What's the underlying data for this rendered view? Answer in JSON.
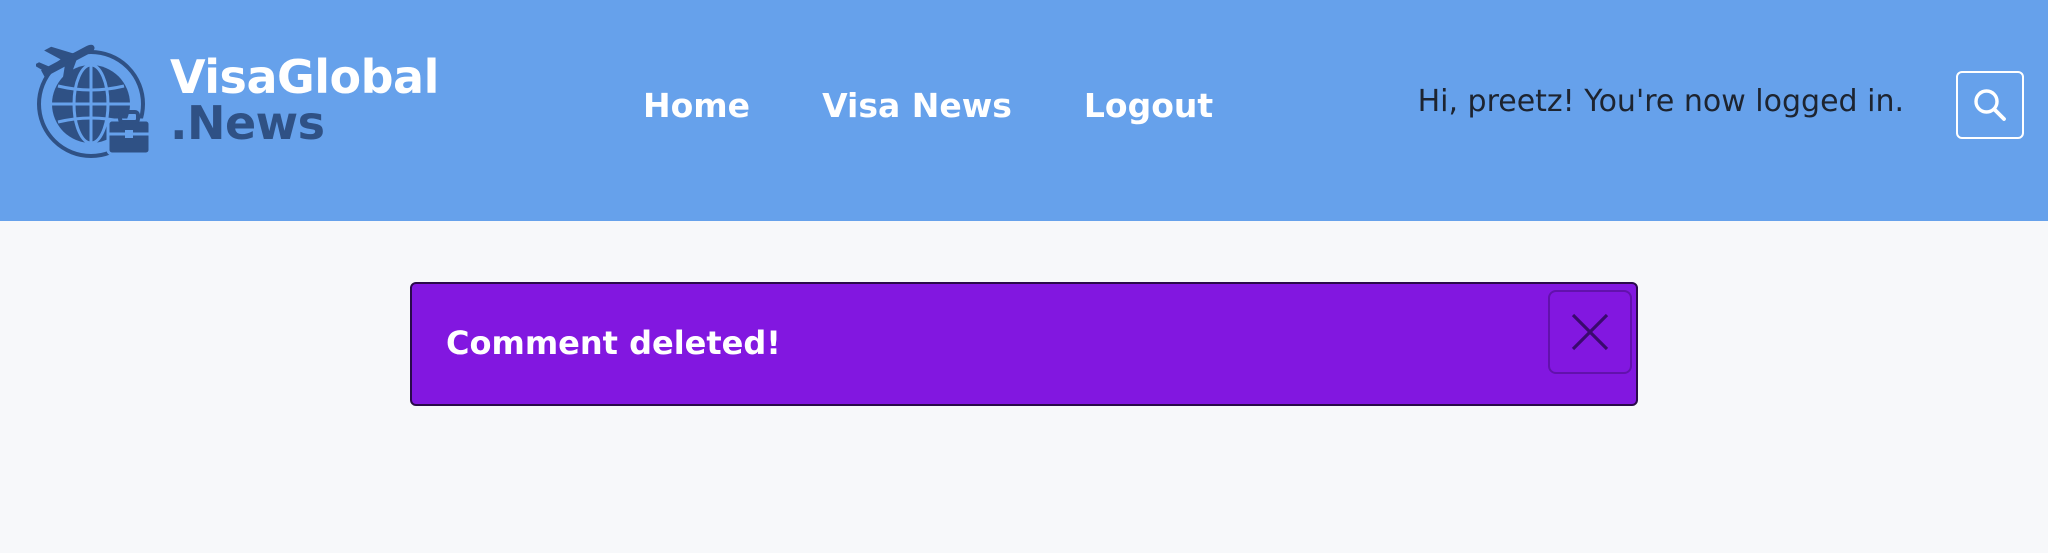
{
  "brand": {
    "line1": "VisaGlobal",
    "line2": ".News",
    "icon": "globe-plane-briefcase-logo"
  },
  "nav": {
    "items": [
      {
        "label": "Home"
      },
      {
        "label": "Visa News"
      },
      {
        "label": "Logout"
      }
    ]
  },
  "header": {
    "greeting": "Hi, preetz! You're now logged in.",
    "search_icon": "search-icon"
  },
  "alert": {
    "message": "Comment deleted!",
    "close_icon": "close-icon"
  },
  "colors": {
    "header_bg": "#66a1eb",
    "page_bg": "#f7f8fa",
    "alert_bg": "#8217e0",
    "brand_dark": "#2f5185"
  }
}
